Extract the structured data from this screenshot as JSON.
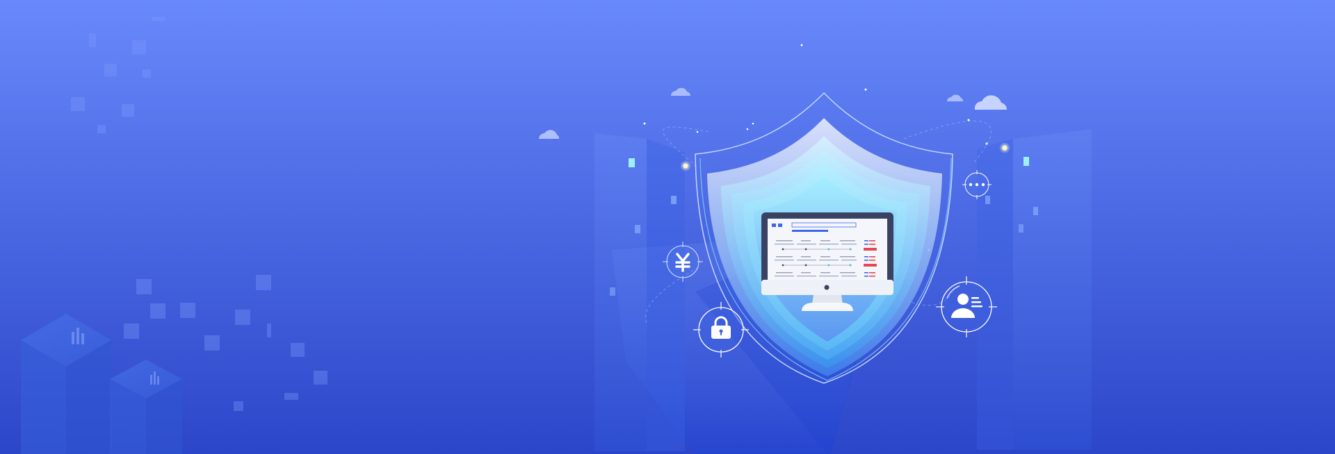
{
  "banner": {
    "theme": "security-shield-illustration",
    "colors": {
      "background_top": "#6889fb",
      "background_bottom": "#2c46c9",
      "shield_light": "#bfeaff",
      "shield_mid": "#4fa6f2",
      "shield_dark": "#2f78e0",
      "monitor_frame": "#3a4263",
      "monitor_screen": "#f4f6fb",
      "accent_blue": "#3f66e8",
      "accent_red": "#e8454f",
      "glow_yellow": "#fff6c8",
      "cloud": "#b7c8ff",
      "icon_white": "#ffffff"
    },
    "icons": [
      "shield-icon",
      "monitor-icon",
      "yuan-icon",
      "lock-icon",
      "user-profile-icon",
      "chat-dots-icon",
      "cloud-icon",
      "isometric-cube-icon"
    ]
  }
}
